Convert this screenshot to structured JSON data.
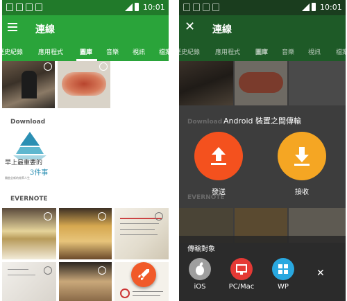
{
  "status": {
    "time": "10:01"
  },
  "app": {
    "title": "連線"
  },
  "tabs": [
    "歷史紀錄",
    "應用程式",
    "圖庫",
    "音樂",
    "視訊",
    "檔案"
  ],
  "active_tab": "圖庫",
  "sections": {
    "download": "Download",
    "evernote": "EVERNOTE"
  },
  "download_preview": {
    "line1": "早上最重要的",
    "line2": "3件事",
    "caption": "開啟全新的效率人生"
  },
  "transfer_sheet": {
    "title": "Android 裝置之間傳輸",
    "send_label": "發送",
    "receive_label": "接收",
    "target_heading": "傳輸對象",
    "targets": [
      {
        "label": "iOS",
        "icon": "apple-icon",
        "color": "#9e9e9e"
      },
      {
        "label": "PC/Mac",
        "icon": "monitor-icon",
        "color": "#e53935"
      },
      {
        "label": "WP",
        "icon": "windows-icon",
        "color": "#29a8e0"
      }
    ]
  },
  "colors": {
    "status_bar": "#217a2a",
    "toolbar": "#2aa43a",
    "send": "#f4511e",
    "receive": "#f5a623"
  }
}
